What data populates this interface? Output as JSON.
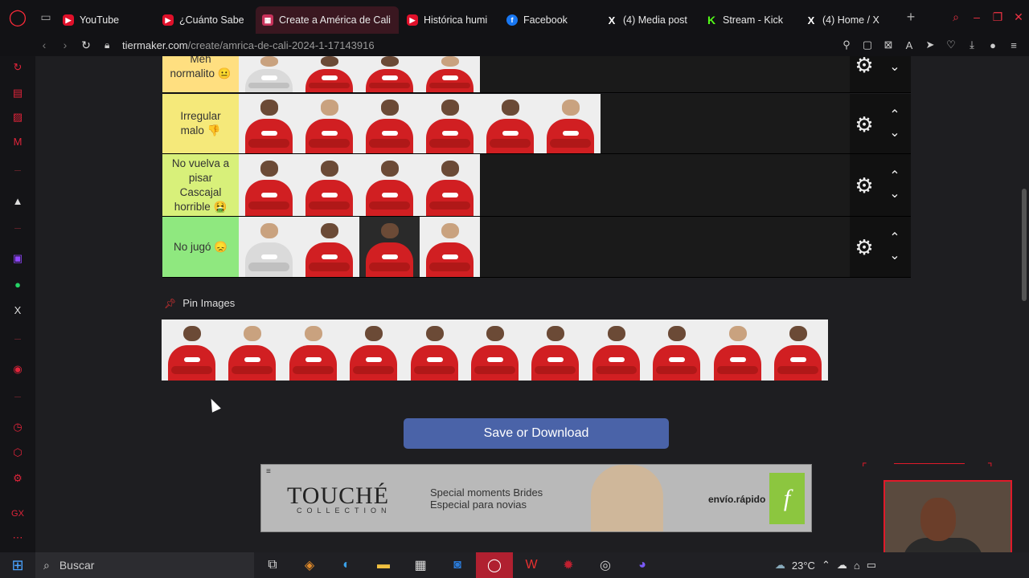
{
  "browser": {
    "tabs": [
      {
        "label": "YouTube",
        "fav": "yt",
        "fav_text": "▶"
      },
      {
        "label": "¿Cuánto Sabe",
        "fav": "yt",
        "fav_text": "▶"
      },
      {
        "label": "Create a América de Cali",
        "fav": "tm",
        "fav_text": "▦",
        "active": true
      },
      {
        "label": "Histórica humi",
        "fav": "yt",
        "fav_text": "▶"
      },
      {
        "label": "Facebook",
        "fav": "fb",
        "fav_text": "f"
      },
      {
        "label": "(4) Media post",
        "fav": "x",
        "fav_text": "X"
      },
      {
        "label": "Stream - Kick",
        "fav": "kick",
        "fav_text": "K"
      },
      {
        "label": "(4) Home / X",
        "fav": "x",
        "fav_text": "X"
      }
    ],
    "url_domain": "tiermaker.com",
    "url_path": "/create/amrica-de-cali-2024-1-17143916"
  },
  "tiers": [
    {
      "label": "Meh normalito 😐",
      "color": "#ffdf80",
      "players": 4
    },
    {
      "label": "Irregular malo 👎",
      "color": "#f5e97a",
      "players": 6
    },
    {
      "label": "No vuelva a pisar Cascajal horrible 🤮",
      "color": "#d8f07a",
      "players": 4
    },
    {
      "label": "No jugó 😞",
      "color": "#8fe87f",
      "players": 4
    }
  ],
  "pin_images": {
    "label": "Pin Images",
    "count": 11
  },
  "save_button": "Save or Download",
  "ad": {
    "mark": "≡",
    "brand": "TOUCHÉ",
    "brand_sub": "COLLECTION",
    "line1": "Special moments Brides",
    "line2": "Especial para novias",
    "envio": "envío.rápido",
    "ff": "f"
  },
  "taskbar": {
    "search_placeholder": "Buscar",
    "temperature": "23°C"
  }
}
